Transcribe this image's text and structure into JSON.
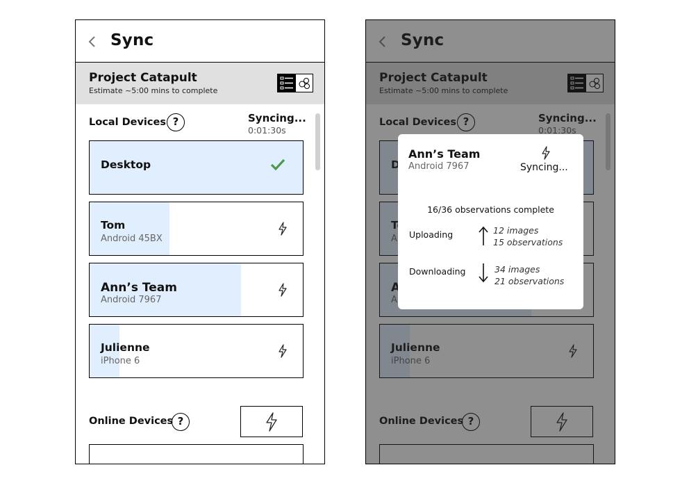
{
  "header": {
    "title": "Sync"
  },
  "project": {
    "title": "Project Catapult",
    "subtitle": "Estimate ~5:00 mins to complete"
  },
  "local_devices": {
    "label": "Local Devices",
    "help": "?",
    "sync_status": "Syncing...",
    "sync_time": "0:01:30s",
    "devices": [
      {
        "name": "Desktop",
        "device": "",
        "status": "done",
        "progress": 1.0
      },
      {
        "name": "Tom",
        "device": "Android 45BX",
        "status": "syncing",
        "progress": 0.375
      },
      {
        "name": "Ann’s Team",
        "device": "Android 7967",
        "status": "syncing",
        "progress": 0.71
      },
      {
        "name": "Julienne",
        "device": "iPhone 6",
        "status": "syncing",
        "progress": 0.14
      }
    ]
  },
  "online_devices": {
    "label": "Online Devices",
    "help": "?"
  },
  "modal": {
    "name": "Ann’s Team",
    "device": "Android 7967",
    "status": "Syncing...",
    "complete": "16/36 observations complete",
    "uploading": {
      "label": "Uploading",
      "images": "12 images",
      "observations": "15 observations"
    },
    "downloading": {
      "label": "Downloading",
      "images": "34 images",
      "observations": "21 observations"
    }
  },
  "colors": {
    "progress_fill": "#e1eefd",
    "check": "#4a9a4a",
    "header_band": "#e0e0e0",
    "overlay": "rgba(40,40,40,0.52)"
  },
  "icons": {
    "back": "chevron-left-icon",
    "list": "list-view-icon",
    "map": "map-view-icon",
    "sync": "lightning-icon",
    "done": "check-icon"
  }
}
